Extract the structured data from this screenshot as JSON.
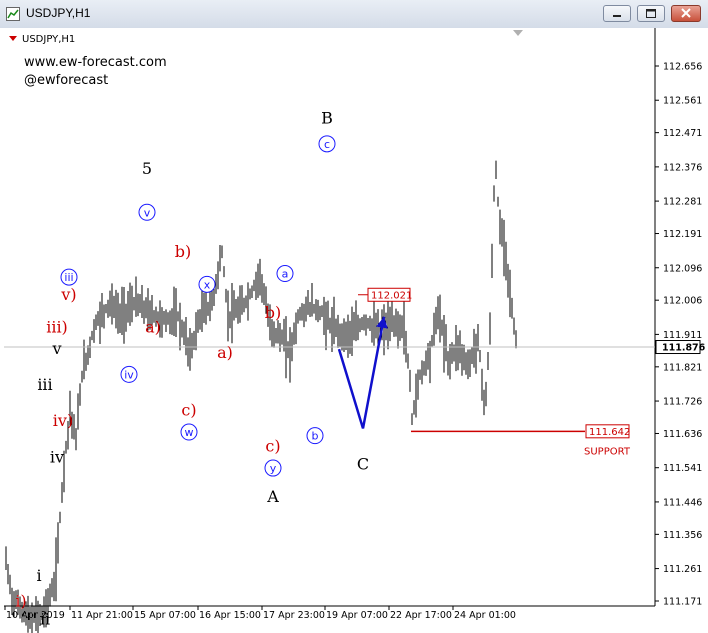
{
  "window": {
    "title": "USDJPY,H1"
  },
  "chart_data": {
    "type": "line",
    "symbol_label": "USDJPY,H1",
    "watermark": [
      "www.ew-forecast.com",
      "@ewforecast"
    ],
    "y_ticks": [
      "112.656",
      "112.561",
      "112.471",
      "112.376",
      "112.281",
      "112.191",
      "112.096",
      "112.006",
      "111.911",
      "111.821",
      "111.726",
      "111.636",
      "111.541",
      "111.446",
      "111.356",
      "111.261",
      "111.171"
    ],
    "x_ticks": [
      "10 Apr 2019",
      "11 Apr 21:00",
      "15 Apr 07:00",
      "16 Apr 15:00",
      "17 Apr 23:00",
      "19 Apr 07:00",
      "22 Apr 17:00",
      "24 Apr 01:00"
    ],
    "ylim": [
      111.15,
      112.72
    ],
    "current_price": "111.876",
    "levels": [
      {
        "label": "112.021",
        "value": 112.021
      },
      {
        "label": "111.642",
        "value": 111.642,
        "note": "SUPPORT"
      }
    ],
    "wave_labels": [
      {
        "text": "i",
        "t": 0.05,
        "price": 111.24,
        "color": "#000000",
        "style": "plain"
      },
      {
        "text": "i)",
        "t": 0.02,
        "price": 111.17,
        "color": "#cc0000",
        "style": "plain"
      },
      {
        "text": "ii",
        "t": 0.06,
        "price": 111.12,
        "color": "#000000",
        "style": "plain"
      },
      {
        "text": "iii",
        "t": 0.06,
        "price": 111.77,
        "color": "#000000",
        "style": "plain"
      },
      {
        "text": "iv",
        "t": 0.08,
        "price": 111.57,
        "color": "#000000",
        "style": "plain"
      },
      {
        "text": "v",
        "t": 0.08,
        "price": 111.87,
        "color": "#000000",
        "style": "plain"
      },
      {
        "text": "iii)",
        "t": 0.08,
        "price": 111.93,
        "color": "#cc0000",
        "style": "plain"
      },
      {
        "text": "iv)",
        "t": 0.09,
        "price": 111.67,
        "color": "#cc0000",
        "style": "plain"
      },
      {
        "text": "v)",
        "t": 0.1,
        "price": 112.02,
        "color": "#cc0000",
        "style": "plain"
      },
      {
        "text": "iii",
        "t": 0.1,
        "price": 112.07,
        "color": "#1a1aff",
        "style": "circle"
      },
      {
        "text": "iv",
        "t": 0.2,
        "price": 111.8,
        "color": "#1a1aff",
        "style": "circle"
      },
      {
        "text": "v",
        "t": 0.23,
        "price": 112.25,
        "color": "#1a1aff",
        "style": "circle"
      },
      {
        "text": "5",
        "t": 0.23,
        "price": 112.37,
        "color": "#000000",
        "style": "plain"
      },
      {
        "text": "a)",
        "t": 0.24,
        "price": 111.93,
        "color": "#cc0000",
        "style": "plain"
      },
      {
        "text": "b)",
        "t": 0.29,
        "price": 112.14,
        "color": "#cc0000",
        "style": "plain"
      },
      {
        "text": "c)",
        "t": 0.3,
        "price": 111.7,
        "color": "#cc0000",
        "style": "plain"
      },
      {
        "text": "w",
        "t": 0.3,
        "price": 111.64,
        "color": "#1a1aff",
        "style": "circle"
      },
      {
        "text": "x",
        "t": 0.33,
        "price": 112.05,
        "color": "#1a1aff",
        "style": "circle"
      },
      {
        "text": "a)",
        "t": 0.36,
        "price": 111.86,
        "color": "#cc0000",
        "style": "plain"
      },
      {
        "text": "b)",
        "t": 0.44,
        "price": 111.97,
        "color": "#cc0000",
        "style": "plain"
      },
      {
        "text": "a",
        "t": 0.46,
        "price": 112.08,
        "color": "#1a1aff",
        "style": "circle"
      },
      {
        "text": "c)",
        "t": 0.44,
        "price": 111.6,
        "color": "#cc0000",
        "style": "plain"
      },
      {
        "text": "y",
        "t": 0.44,
        "price": 111.54,
        "color": "#1a1aff",
        "style": "circle"
      },
      {
        "text": "A",
        "t": 0.44,
        "price": 111.46,
        "color": "#000000",
        "style": "plain"
      },
      {
        "text": "b",
        "t": 0.51,
        "price": 111.63,
        "color": "#1a1aff",
        "style": "circle"
      },
      {
        "text": "c",
        "t": 0.53,
        "price": 112.44,
        "color": "#1a1aff",
        "style": "circle"
      },
      {
        "text": "B",
        "t": 0.53,
        "price": 112.51,
        "color": "#000000",
        "style": "plain"
      },
      {
        "text": "C",
        "t": 0.59,
        "price": 111.55,
        "color": "#000000",
        "style": "plain"
      }
    ],
    "projection": [
      {
        "t": 0.55,
        "price": 111.87
      },
      {
        "t": 0.59,
        "price": 111.65
      },
      {
        "t": 0.625,
        "price": 111.96
      }
    ]
  }
}
